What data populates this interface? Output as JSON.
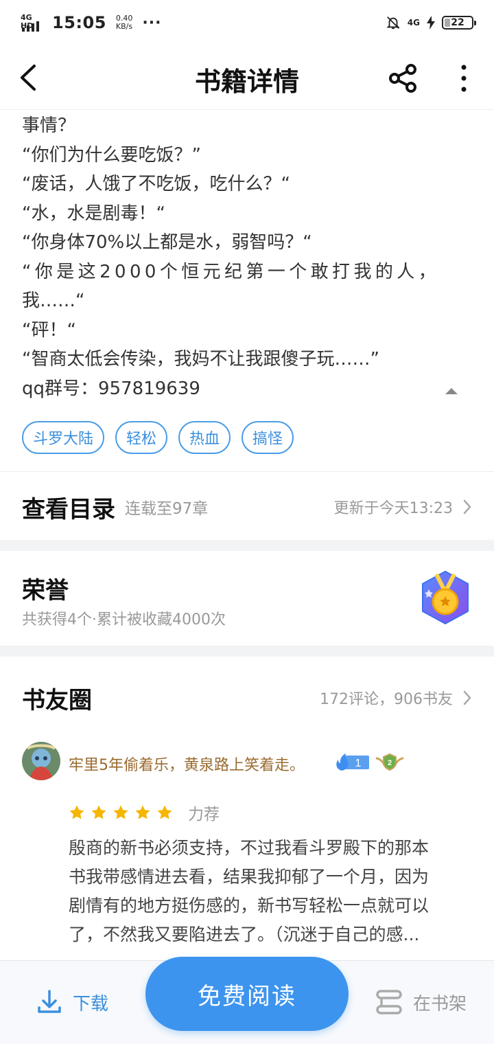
{
  "status_bar": {
    "network": "4G HD",
    "time": "15:05",
    "speed_value": "0.40",
    "speed_unit": "KB/s",
    "right_network": "4G",
    "battery": "22"
  },
  "header": {
    "title": "书籍详情"
  },
  "intro": {
    "lines": [
      "事情？",
      "“你们为什么要吃饭？”",
      "“废话，人饿了不吃饭，吃什么？“",
      "“水，水是剧毒！“",
      "“你身体70%以上都是水，弱智吗？“",
      "“你是这2000个恒元纪第一个敢打我的人，",
      "我……“",
      "“砰！“",
      "“智商太低会传染，我妈不让我跟傻子玩……”",
      "qq群号：957819639"
    ]
  },
  "tags": [
    "斗罗大陆",
    "轻松",
    "热血",
    "搞怪"
  ],
  "catalog": {
    "heading": "查看目录",
    "progress": "连载至97章",
    "updated": "更新于今天13:23"
  },
  "honor": {
    "heading": "荣誉",
    "summary": "共获得4个·累计被收藏4000次"
  },
  "circle": {
    "heading": "书友圈",
    "counts": "172评论，906书友",
    "comment": {
      "user": "牢里5年偷着乐，黄泉路上笑着走。",
      "fire_level": "1",
      "rank_level": "2",
      "stars": 5,
      "rating_label": "力荐",
      "lines": [
        "殷商的新书必须支持，不过我看斗罗殿下的那本",
        "书我带感情进去看，结果我抑郁了一个月，因为",
        "剧情有的地方挺伤感的，新书写轻松一点就可以",
        "了，不然我又要陷进去了。（沉迷于自己的感..."
      ]
    }
  },
  "bottom_bar": {
    "download": "下载",
    "read": "免费阅读",
    "shelf": "在书架"
  },
  "colors": {
    "accent": "#3d94ee",
    "username": "#9a6a2e",
    "star": "#f6b500"
  }
}
